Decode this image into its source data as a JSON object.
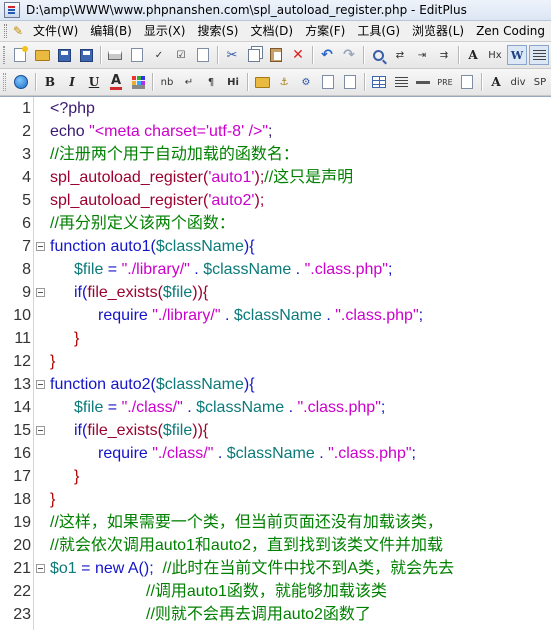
{
  "window": {
    "title": "D:\\amp\\WWW\\www.phpnanshen.com\\spl_autoload_register.php - EditPlus"
  },
  "menu": {
    "items": [
      {
        "label": "文件(W)"
      },
      {
        "label": "编辑(B)"
      },
      {
        "label": "显示(X)"
      },
      {
        "label": "搜索(S)"
      },
      {
        "label": "文档(D)"
      },
      {
        "label": "方案(F)"
      },
      {
        "label": "工具(G)"
      },
      {
        "label": "浏览器(L)"
      },
      {
        "label": "Zen Coding"
      }
    ]
  },
  "toolbar2": {
    "bold": "B",
    "italic": "I",
    "underline": "U",
    "font_color": "A",
    "nbsp": "nb",
    "br": "↵",
    "para": "¶",
    "hi": "Hi",
    "pre": "PRE",
    "hx": "Hx",
    "div": "div",
    "sp": "SP"
  },
  "colors": {
    "string": "#cc00cc",
    "keyword": "#1515c8",
    "variable": "#0c7a7a",
    "comment": "#008000",
    "function": "#9b0030"
  },
  "editor": {
    "lines": [
      {
        "n": "1",
        "fold": false,
        "indent": 0,
        "tokens": [
          {
            "t": "<?php",
            "c": "dark"
          }
        ]
      },
      {
        "n": "2",
        "fold": false,
        "indent": 0,
        "tokens": [
          {
            "t": "echo ",
            "c": "dark"
          },
          {
            "t": "\"<meta charset='utf-8' />\"",
            "c": "str"
          },
          {
            "t": ";",
            "c": "dark"
          }
        ]
      },
      {
        "n": "3",
        "fold": false,
        "indent": 0,
        "tokens": [
          {
            "t": "//注册两个用于自动加载的函数名：",
            "c": "com"
          }
        ]
      },
      {
        "n": "4",
        "fold": false,
        "indent": 0,
        "tokens": [
          {
            "t": "spl_autoload_register(",
            "c": "fn"
          },
          {
            "t": "'auto1'",
            "c": "str"
          },
          {
            "t": ");",
            "c": "fn"
          },
          {
            "t": "//这只是声明",
            "c": "com"
          }
        ]
      },
      {
        "n": "5",
        "fold": false,
        "indent": 0,
        "tokens": [
          {
            "t": "spl_autoload_register(",
            "c": "fn"
          },
          {
            "t": "'auto2'",
            "c": "str"
          },
          {
            "t": ");",
            "c": "fn"
          }
        ]
      },
      {
        "n": "6",
        "fold": false,
        "indent": 0,
        "tokens": [
          {
            "t": "//再分别定义该两个函数：",
            "c": "com"
          }
        ]
      },
      {
        "n": "7",
        "fold": true,
        "indent": 0,
        "tokens": [
          {
            "t": "function ",
            "c": "kw"
          },
          {
            "t": "auto1(",
            "c": "kw"
          },
          {
            "t": "$className",
            "c": "var"
          },
          {
            "t": "){",
            "c": "kw"
          }
        ]
      },
      {
        "n": "8",
        "fold": false,
        "indent": 1,
        "tokens": [
          {
            "t": "$file",
            "c": "var"
          },
          {
            "t": " = ",
            "c": "kw"
          },
          {
            "t": "\"./library/\"",
            "c": "str"
          },
          {
            "t": " . ",
            "c": "kw"
          },
          {
            "t": "$className",
            "c": "var"
          },
          {
            "t": " . ",
            "c": "kw"
          },
          {
            "t": "\".class.php\"",
            "c": "str"
          },
          {
            "t": ";",
            "c": "kw"
          }
        ]
      },
      {
        "n": "9",
        "fold": true,
        "indent": 1,
        "tokens": [
          {
            "t": "if(",
            "c": "kw"
          },
          {
            "t": "file_exists(",
            "c": "fn"
          },
          {
            "t": "$file",
            "c": "var"
          },
          {
            "t": ")){",
            "c": "fn"
          }
        ]
      },
      {
        "n": "10",
        "fold": false,
        "indent": 2,
        "tokens": [
          {
            "t": "require ",
            "c": "kw"
          },
          {
            "t": "\"./library/\"",
            "c": "str"
          },
          {
            "t": " . ",
            "c": "kw"
          },
          {
            "t": "$className",
            "c": "var"
          },
          {
            "t": " . ",
            "c": "kw"
          },
          {
            "t": "\".class.php\"",
            "c": "str"
          },
          {
            "t": ";",
            "c": "kw"
          }
        ]
      },
      {
        "n": "11",
        "fold": false,
        "indent": 1,
        "tokens": [
          {
            "t": "}",
            "c": "brk"
          }
        ]
      },
      {
        "n": "12",
        "fold": false,
        "indent": 0,
        "tokens": [
          {
            "t": "}",
            "c": "brk"
          }
        ]
      },
      {
        "n": "13",
        "fold": true,
        "indent": 0,
        "tokens": [
          {
            "t": "function ",
            "c": "kw"
          },
          {
            "t": "auto2(",
            "c": "kw"
          },
          {
            "t": "$className",
            "c": "var"
          },
          {
            "t": "){",
            "c": "kw"
          }
        ]
      },
      {
        "n": "14",
        "fold": false,
        "indent": 1,
        "tokens": [
          {
            "t": "$file",
            "c": "var"
          },
          {
            "t": " = ",
            "c": "kw"
          },
          {
            "t": "\"./class/\"",
            "c": "str"
          },
          {
            "t": " . ",
            "c": "kw"
          },
          {
            "t": "$className",
            "c": "var"
          },
          {
            "t": " . ",
            "c": "kw"
          },
          {
            "t": "\".class.php\"",
            "c": "str"
          },
          {
            "t": ";",
            "c": "kw"
          }
        ]
      },
      {
        "n": "15",
        "fold": true,
        "indent": 1,
        "tokens": [
          {
            "t": "if(",
            "c": "kw"
          },
          {
            "t": "file_exists(",
            "c": "fn"
          },
          {
            "t": "$file",
            "c": "var"
          },
          {
            "t": ")){",
            "c": "fn"
          }
        ]
      },
      {
        "n": "16",
        "fold": false,
        "indent": 2,
        "tokens": [
          {
            "t": "require ",
            "c": "kw"
          },
          {
            "t": "\"./class/\"",
            "c": "str"
          },
          {
            "t": " . ",
            "c": "kw"
          },
          {
            "t": "$className",
            "c": "var"
          },
          {
            "t": " . ",
            "c": "kw"
          },
          {
            "t": "\".class.php\"",
            "c": "str"
          },
          {
            "t": ";",
            "c": "kw"
          }
        ]
      },
      {
        "n": "17",
        "fold": false,
        "indent": 1,
        "tokens": [
          {
            "t": "}",
            "c": "brk"
          }
        ]
      },
      {
        "n": "18",
        "fold": false,
        "indent": 0,
        "tokens": [
          {
            "t": "}",
            "c": "brk"
          }
        ]
      },
      {
        "n": "19",
        "fold": false,
        "indent": 0,
        "tokens": [
          {
            "t": "//这样，如果需要一个类，但当前页面还没有加载该类，",
            "c": "com"
          }
        ]
      },
      {
        "n": "20",
        "fold": false,
        "indent": 0,
        "tokens": [
          {
            "t": "//就会依次调用auto1和auto2，直到找到该类文件并加载",
            "c": "com"
          }
        ]
      },
      {
        "n": "21",
        "fold": true,
        "indent": 0,
        "tokens": [
          {
            "t": "$o1",
            "c": "var"
          },
          {
            "t": " = ",
            "c": "kw"
          },
          {
            "t": "new ",
            "c": "kw"
          },
          {
            "t": "A();  ",
            "c": "kw"
          },
          {
            "t": "//此时在当前文件中找不到A类，就会先去",
            "c": "com"
          }
        ]
      },
      {
        "n": "22",
        "fold": false,
        "indent": 4,
        "tokens": [
          {
            "t": "//调用auto1函数，就能够加载该类",
            "c": "com"
          }
        ]
      },
      {
        "n": "23",
        "fold": false,
        "indent": 4,
        "tokens": [
          {
            "t": "//则就不会再去调用auto2函数了",
            "c": "com"
          }
        ]
      }
    ]
  }
}
